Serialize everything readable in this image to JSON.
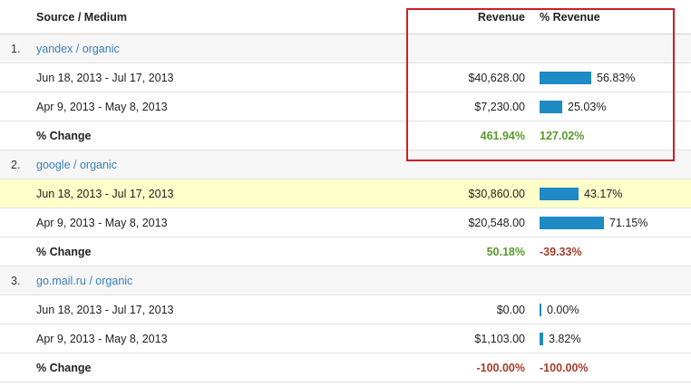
{
  "header": {
    "source_medium": "Source / Medium",
    "revenue": "Revenue",
    "pct_revenue": "% Revenue"
  },
  "groups": [
    {
      "index": "1.",
      "source": "yandex / organic",
      "rows": [
        {
          "period": "Jun 18, 2013 - Jul 17, 2013",
          "revenue": "$40,628.00",
          "pct": "56.83%",
          "pct_value": 56.83
        },
        {
          "period": "Apr 9, 2013 - May 8, 2013",
          "revenue": "$7,230.00",
          "pct": "25.03%",
          "pct_value": 25.03
        }
      ],
      "change": {
        "label": "% Change",
        "revenue": "461.94%",
        "pct": "127.02%",
        "revenue_color": "#5a9a2a",
        "pct_color": "#5a9a2a"
      }
    },
    {
      "index": "2.",
      "source": "google / organic",
      "rows": [
        {
          "period": "Jun 18, 2013 - Jul 17, 2013",
          "revenue": "$30,860.00",
          "pct": "43.17%",
          "pct_value": 43.17
        },
        {
          "period": "Apr 9, 2013 - May 8, 2013",
          "revenue": "$20,548.00",
          "pct": "71.15%",
          "pct_value": 71.15
        }
      ],
      "change": {
        "label": "% Change",
        "revenue": "50.18%",
        "pct": "-39.33%",
        "revenue_color": "#5a9a2a",
        "pct_color": "#a53d2a"
      }
    },
    {
      "index": "3.",
      "source": "go.mail.ru / organic",
      "rows": [
        {
          "period": "Jun 18, 2013 - Jul 17, 2013",
          "revenue": "$0.00",
          "pct": "0.00%",
          "pct_value": 0
        },
        {
          "period": "Apr 9, 2013 - May 8, 2013",
          "revenue": "$1,103.00",
          "pct": "3.82%",
          "pct_value": 3.82
        }
      ],
      "change": {
        "label": "% Change",
        "revenue": "-100.00%",
        "pct": "-100.00%",
        "revenue_color": "#a53d2a",
        "pct_color": "#a53d2a"
      }
    }
  ],
  "colors": {
    "bar": "#1f8ac4",
    "positive": "#5a9a2a",
    "negative": "#a53d2a",
    "highlight_row": "#ffffc9",
    "annotation_box": "#cc1f27"
  }
}
